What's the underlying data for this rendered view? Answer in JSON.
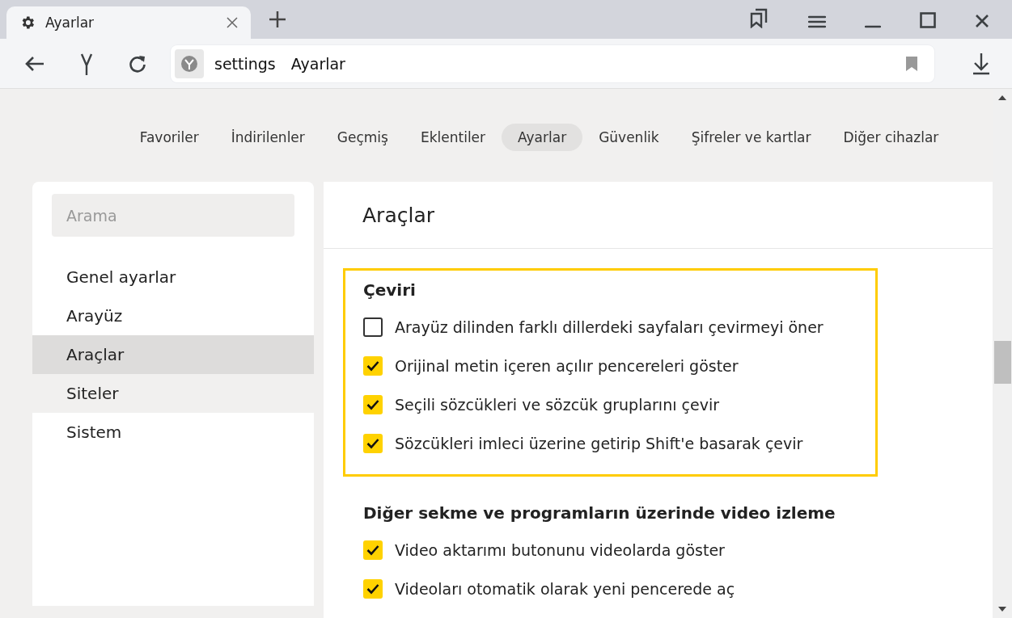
{
  "window": {
    "tab_title": "Ayarlar"
  },
  "address_bar": {
    "scheme": "settings",
    "page": "Ayarlar"
  },
  "nav_tabs": [
    {
      "label": "Favoriler",
      "selected": false
    },
    {
      "label": "İndirilenler",
      "selected": false
    },
    {
      "label": "Geçmiş",
      "selected": false
    },
    {
      "label": "Eklentiler",
      "selected": false
    },
    {
      "label": "Ayarlar",
      "selected": true
    },
    {
      "label": "Güvenlik",
      "selected": false
    },
    {
      "label": "Şifreler ve kartlar",
      "selected": false
    },
    {
      "label": "Diğer cihazlar",
      "selected": false
    }
  ],
  "sidebar": {
    "search": {
      "placeholder": "Arama"
    },
    "items": [
      {
        "label": "Genel ayarlar",
        "selected": false,
        "hovered": false
      },
      {
        "label": "Arayüz",
        "selected": false,
        "hovered": false
      },
      {
        "label": "Araçlar",
        "selected": true,
        "hovered": false
      },
      {
        "label": "Siteler",
        "selected": false,
        "hovered": true
      },
      {
        "label": "Sistem",
        "selected": false,
        "hovered": false
      }
    ]
  },
  "main": {
    "title": "Araçlar",
    "sections": [
      {
        "title": "Çeviri",
        "highlighted": true,
        "options": [
          {
            "label": "Arayüz dilinden farklı dillerdeki sayfaları çevirmeyi öner",
            "checked": false
          },
          {
            "label": "Orijinal metin içeren açılır pencereleri göster",
            "checked": true
          },
          {
            "label": "Seçili sözcükleri ve sözcük gruplarını çevir",
            "checked": true
          },
          {
            "label": "Sözcükleri imleci üzerine getirip Shift'e basarak çevir",
            "checked": true
          }
        ]
      },
      {
        "title": "Diğer sekme ve programların üzerinde video izleme",
        "options": [
          {
            "label": "Video aktarımı butonunu videolarda göster",
            "checked": true
          },
          {
            "label": "Videoları otomatik olarak yeni pencerede aç",
            "checked": true
          }
        ]
      }
    ]
  }
}
